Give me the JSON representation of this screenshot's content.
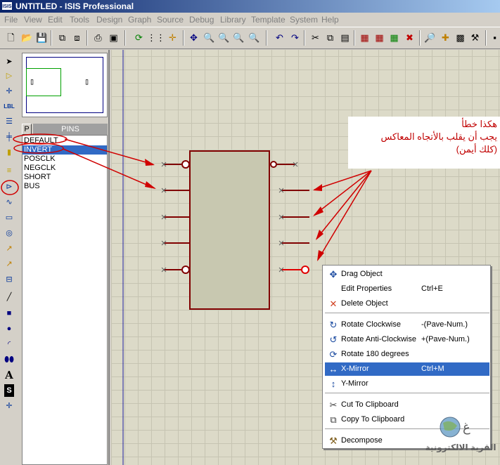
{
  "window": {
    "app_badge": "ISIS",
    "title": "UNTITLED - ISIS Professional"
  },
  "menu": [
    "File",
    "View",
    "Edit",
    "Tools",
    "Design",
    "Graph",
    "Source",
    "Debug",
    "Library",
    "Template",
    "System",
    "Help"
  ],
  "toolbar_icons": [
    "new-icon",
    "open-icon",
    "save-icon",
    "import-icon",
    "export-icon",
    "print-icon",
    "area-icon",
    "refresh-icon",
    "grid-icon",
    "origin-icon",
    "pan-icon",
    "zoom-in-icon",
    "zoom-out-icon",
    "zoom-all-icon",
    "zoom-area-icon",
    "undo-icon",
    "redo-icon",
    "cut-icon",
    "copy-icon",
    "paste-icon",
    "block-copy-icon",
    "block-move-icon",
    "block-rotate-icon",
    "block-delete-icon",
    "pick-icon",
    "make-device-icon",
    "package-icon",
    "decompose-icon"
  ],
  "left_tools": [
    "pointer-icon",
    "component-icon",
    "junction-icon",
    "wire-label-icon",
    "text-script-icon",
    "bus-icon",
    "subcircuit-icon",
    "terminal-icon",
    "device-pin-icon",
    "graph-icon",
    "tape-icon",
    "generator-icon",
    "voltage-probe-icon",
    "current-probe-icon",
    "virtual-instrument-icon",
    "line-icon",
    "box-icon",
    "circle-icon",
    "arc-icon",
    "path-icon",
    "text-icon",
    "symbol-icon",
    "marker-icon"
  ],
  "left_tool_labels": {
    "wire_label": "LBL",
    "text": "A",
    "symbol": "S"
  },
  "pins_panel": {
    "toggle": "P",
    "caption": "PINS",
    "items": [
      "DEFAULT",
      "INVERT",
      "POSCLK",
      "NEGCLK",
      "SHORT",
      "BUS"
    ],
    "selected_index": 1
  },
  "annotation": {
    "lines": [
      "هكذا خطأ",
      "يجب أن يقلب بالأتجاه المعاكس",
      "(كلك أيمن)"
    ]
  },
  "context_menu": {
    "items": [
      {
        "icon": "move-icon",
        "label": "Drag Object",
        "shortcut": ""
      },
      {
        "icon": "",
        "label": "Edit Properties",
        "shortcut": "Ctrl+E"
      },
      {
        "icon": "delete-icon",
        "label": "Delete Object",
        "shortcut": ""
      },
      {
        "icon": "rotate-cw-icon",
        "label": "Rotate Clockwise",
        "shortcut": "-(Pave-Num.)"
      },
      {
        "icon": "rotate-ccw-icon",
        "label": "Rotate Anti-Clockwise",
        "shortcut": "+(Pave-Num.)"
      },
      {
        "icon": "rotate-180-icon",
        "label": "Rotate 180 degrees",
        "shortcut": ""
      },
      {
        "icon": "x-mirror-icon",
        "label": "X-Mirror",
        "shortcut": "Ctrl+M"
      },
      {
        "icon": "y-mirror-icon",
        "label": "Y-Mirror",
        "shortcut": ""
      },
      {
        "icon": "cut-icon",
        "label": "Cut To Clipboard",
        "shortcut": ""
      },
      {
        "icon": "copy-icon",
        "label": "Copy To Clipboard",
        "shortcut": ""
      },
      {
        "icon": "decompose-icon",
        "label": "Decompose",
        "shortcut": ""
      }
    ],
    "highlighted_index": 6
  },
  "watermark": {
    "text": "القرية الالكترونية"
  },
  "colors": {
    "annotation": "#cc0000",
    "component_body": "#c8c8b0",
    "component_outline": "#800000",
    "selection": "#316ac5"
  }
}
